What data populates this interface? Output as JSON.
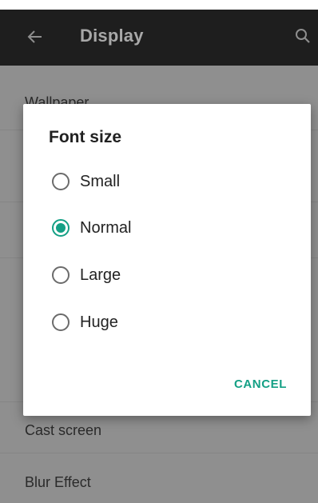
{
  "appbar": {
    "title": "Display",
    "back_icon": "arrow-left-icon",
    "search_icon": "search-icon"
  },
  "settings": {
    "items": [
      {
        "label": "Wallpaper"
      },
      {
        "label": "Cast screen"
      },
      {
        "label": "Blur Effect"
      }
    ]
  },
  "dialog": {
    "title": "Font size",
    "options": [
      {
        "label": "Small",
        "checked": false
      },
      {
        "label": "Normal",
        "checked": true
      },
      {
        "label": "Large",
        "checked": false
      },
      {
        "label": "Huge",
        "checked": false
      }
    ],
    "cancel_label": "CANCEL"
  },
  "colors": {
    "accent": "#14a085",
    "appbar_bg": "#1e1e1e",
    "dimmed_bg": "#8f8f8f",
    "dialog_bg": "#ffffff"
  }
}
